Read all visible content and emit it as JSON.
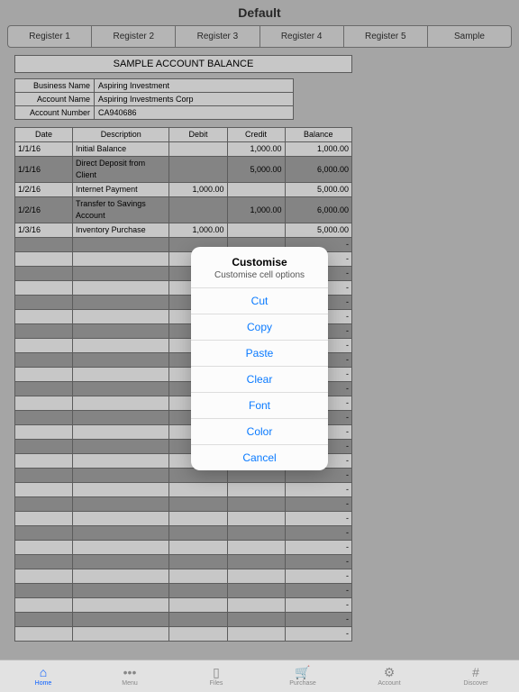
{
  "header": {
    "title": "Default"
  },
  "tabs": [
    "Register 1",
    "Register 2",
    "Register 3",
    "Register 4",
    "Register 5",
    "Sample"
  ],
  "sheet": {
    "title": "SAMPLE ACCOUNT BALANCE",
    "info": [
      {
        "label": "Business Name",
        "value": "Aspiring Investment"
      },
      {
        "label": "Account Name",
        "value": "Aspiring Investments Corp"
      },
      {
        "label": "Account Number",
        "value": "CA940686"
      }
    ],
    "columns": [
      "Date",
      "Description",
      "Debit",
      "Credit",
      "Balance"
    ],
    "rows": [
      {
        "date": "1/1/16",
        "desc": "Initial Balance",
        "debit": "",
        "credit": "1,000.00",
        "balance": "1,000.00"
      },
      {
        "date": "1/1/16",
        "desc": "Direct Deposit from Client",
        "debit": "",
        "credit": "5,000.00",
        "balance": "6,000.00"
      },
      {
        "date": "1/2/16",
        "desc": "Internet Payment",
        "debit": "1,000.00",
        "credit": "",
        "balance": "5,000.00"
      },
      {
        "date": "1/2/16",
        "desc": "Transfer to Savings Account",
        "debit": "",
        "credit": "1,000.00",
        "balance": "6,000.00"
      },
      {
        "date": "1/3/16",
        "desc": "Inventory Purchase",
        "debit": "1,000.00",
        "credit": "",
        "balance": "5,000.00"
      }
    ],
    "empty_row_dash": "-",
    "empty_rows": 28
  },
  "modal": {
    "title": "Customise",
    "subtitle": "Customise cell options",
    "options": [
      "Cut",
      "Copy",
      "Paste",
      "Clear",
      "Font",
      "Color",
      "Cancel"
    ]
  },
  "bottom": [
    {
      "label": "Home",
      "icon": "⌂"
    },
    {
      "label": "Menu",
      "icon": "•••"
    },
    {
      "label": "Files",
      "icon": "▯"
    },
    {
      "label": "Purchase",
      "icon": "🛒"
    },
    {
      "label": "Account",
      "icon": "⚙"
    },
    {
      "label": "Discover",
      "icon": "#"
    }
  ]
}
